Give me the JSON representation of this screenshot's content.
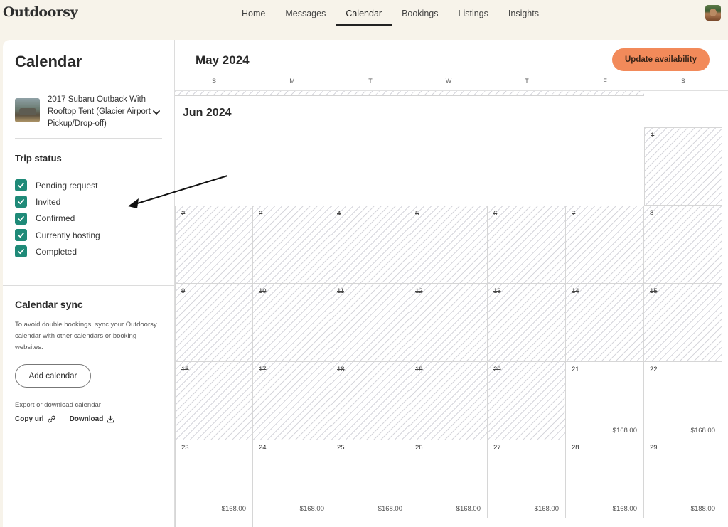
{
  "nav": {
    "logo": "Outdoorsy",
    "items": [
      {
        "label": "Home",
        "active": false
      },
      {
        "label": "Messages",
        "active": false
      },
      {
        "label": "Calendar",
        "active": true
      },
      {
        "label": "Bookings",
        "active": false
      },
      {
        "label": "Listings",
        "active": false
      },
      {
        "label": "Insights",
        "active": false
      }
    ]
  },
  "sidebar": {
    "title": "Calendar",
    "listing_name": "2017 Subaru Outback With Rooftop Tent (Glacier Airport Pickup/Drop-off)",
    "trip_status_title": "Trip status",
    "statuses": [
      {
        "label": "Pending request",
        "checked": true
      },
      {
        "label": "Invited",
        "checked": true
      },
      {
        "label": "Confirmed",
        "checked": true
      },
      {
        "label": "Currently hosting",
        "checked": true
      },
      {
        "label": "Completed",
        "checked": true
      }
    ],
    "sync_title": "Calendar sync",
    "sync_desc": "To avoid double bookings, sync your Outdoorsy calendar with other calendars or booking websites.",
    "add_calendar": "Add calendar",
    "export_label": "Export or download calendar",
    "copy_url": "Copy url",
    "download": "Download"
  },
  "calendar": {
    "prev_month": "May 2024",
    "month": "Jun 2024",
    "update_btn": "Update availability",
    "weekdays": [
      "S",
      "M",
      "T",
      "W",
      "T",
      "F",
      "S"
    ],
    "weeks": [
      [
        null,
        null,
        null,
        null,
        null,
        null,
        {
          "day": "1",
          "blocked": true,
          "price": ""
        }
      ],
      [
        {
          "day": "2",
          "blocked": true,
          "price": ""
        },
        {
          "day": "3",
          "blocked": true,
          "price": ""
        },
        {
          "day": "4",
          "blocked": true,
          "price": ""
        },
        {
          "day": "5",
          "blocked": true,
          "price": ""
        },
        {
          "day": "6",
          "blocked": true,
          "price": ""
        },
        {
          "day": "7",
          "blocked": true,
          "price": ""
        },
        {
          "day": "8",
          "blocked": true,
          "price": ""
        }
      ],
      [
        {
          "day": "9",
          "blocked": true,
          "price": ""
        },
        {
          "day": "10",
          "blocked": true,
          "price": ""
        },
        {
          "day": "11",
          "blocked": true,
          "price": ""
        },
        {
          "day": "12",
          "blocked": true,
          "price": ""
        },
        {
          "day": "13",
          "blocked": true,
          "price": ""
        },
        {
          "day": "14",
          "blocked": true,
          "price": ""
        },
        {
          "day": "15",
          "blocked": true,
          "price": ""
        }
      ],
      [
        {
          "day": "16",
          "blocked": true,
          "price": ""
        },
        {
          "day": "17",
          "blocked": true,
          "price": ""
        },
        {
          "day": "18",
          "blocked": true,
          "price": ""
        },
        {
          "day": "19",
          "blocked": true,
          "price": ""
        },
        {
          "day": "20",
          "blocked": true,
          "price": ""
        },
        {
          "day": "21",
          "blocked": false,
          "price": "$168.00"
        },
        {
          "day": "22",
          "blocked": false,
          "price": "$168.00"
        }
      ],
      [
        {
          "day": "23",
          "blocked": false,
          "price": "$168.00"
        },
        {
          "day": "24",
          "blocked": false,
          "price": "$168.00"
        },
        {
          "day": "25",
          "blocked": false,
          "price": "$168.00"
        },
        {
          "day": "26",
          "blocked": false,
          "price": "$168.00"
        },
        {
          "day": "27",
          "blocked": false,
          "price": "$168.00"
        },
        {
          "day": "28",
          "blocked": false,
          "price": "$168.00"
        },
        {
          "day": "29",
          "blocked": false,
          "price": "$188.00"
        }
      ]
    ]
  },
  "colors": {
    "accent": "#f28a5a",
    "checkbox": "#1f8a78",
    "background": "#f7f3ea"
  }
}
